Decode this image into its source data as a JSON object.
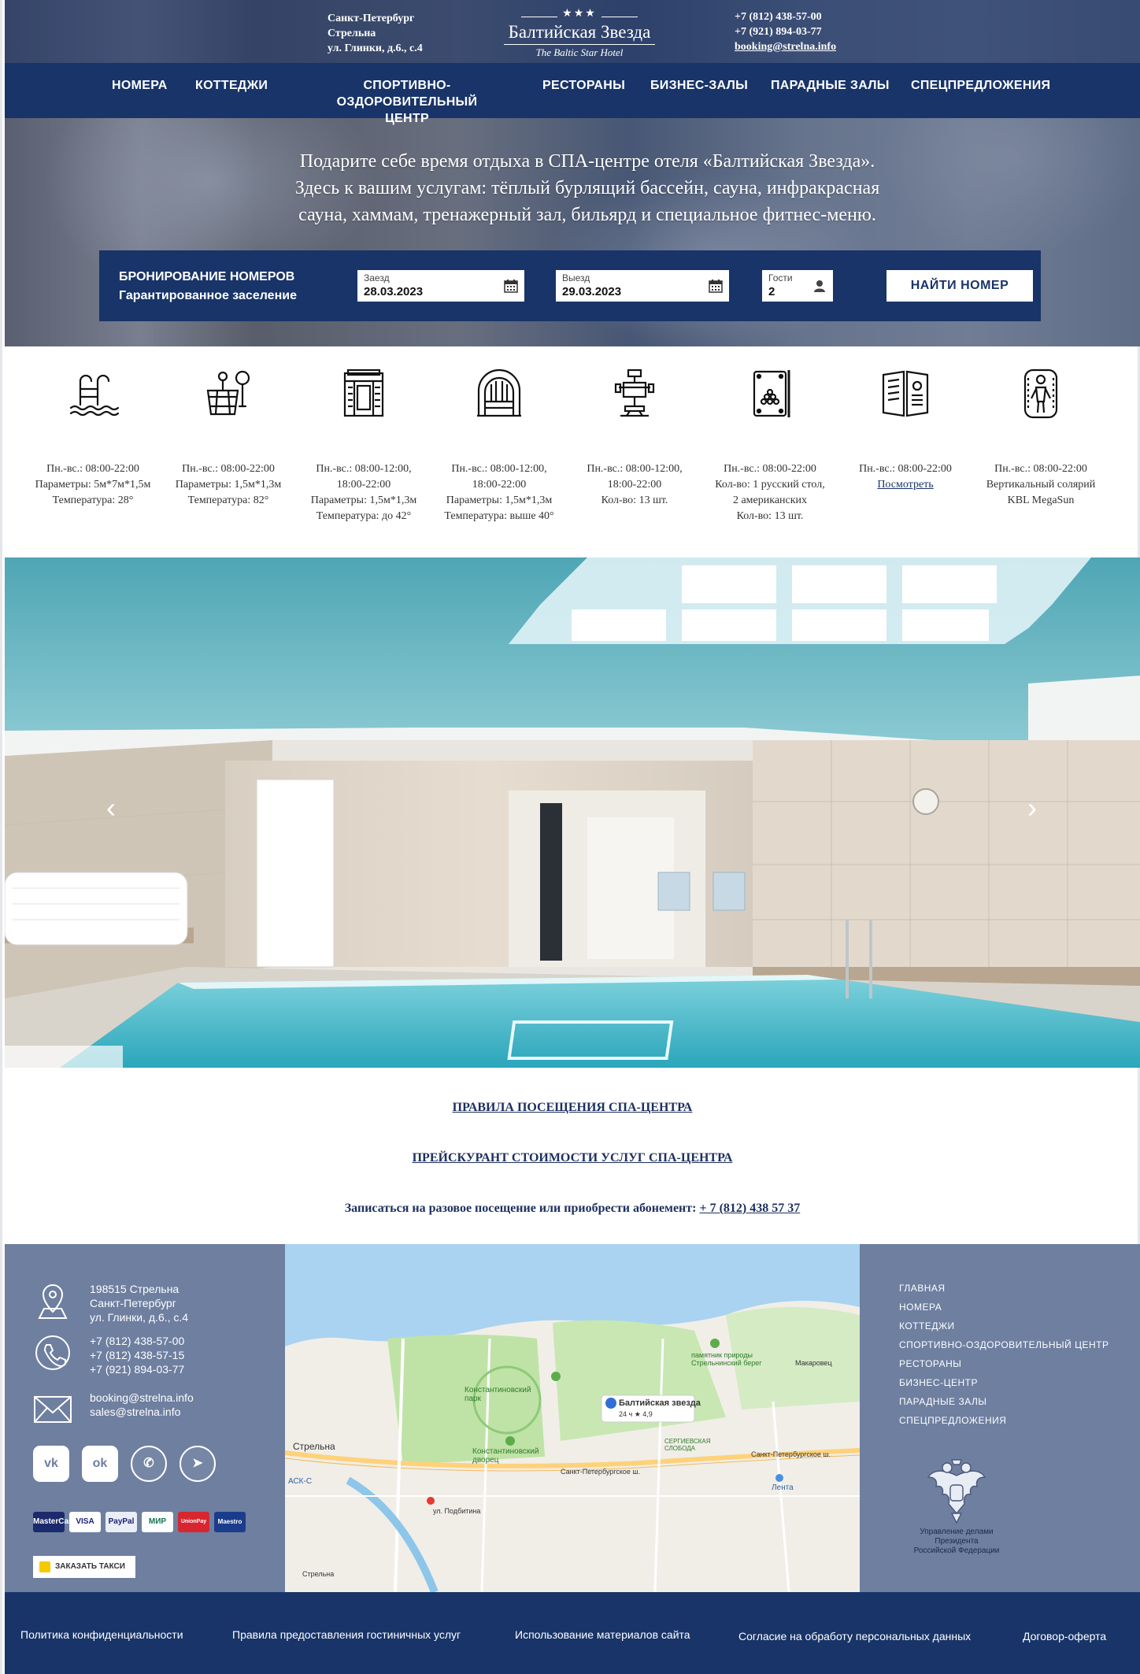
{
  "header": {
    "address_lines": [
      "Санкт-Петербург",
      "Стрельна",
      "ул. Глинки, д.6., с.4"
    ],
    "logo": {
      "stars": "★★★",
      "name": "Балтийская Звезда",
      "subtitle": "The Baltic Star Hotel"
    },
    "phones": [
      "+7 (812) 438-57-00",
      "+7 (921) 894-03-77"
    ],
    "email": "booking@strelna.info"
  },
  "nav": {
    "items": [
      "НОМЕРА",
      "КОТТЕДЖИ",
      "СПОРТИВНО-ОЗДОРОВИТЕЛЬНЫЙ",
      "ЦЕНТР",
      "РЕСТОРАНЫ",
      "БИЗНЕС-ЗАЛЫ",
      "ПАРАДНЫЕ ЗАЛЫ",
      "СПЕЦПРЕДЛОЖЕНИЯ"
    ]
  },
  "banner": {
    "lines": [
      "Подарите себе время отдыха в СПА-центре отеля «Балтийская Звезда».",
      "Здесь к вашим услугам: тёплый бурлящий бассейн, сауна, инфракрасная",
      "сауна, хаммам, тренажерный зал, бильярд и специальное фитнес-меню."
    ]
  },
  "booking": {
    "title": "БРОНИРОВАНИЕ НОМЕРОВ",
    "subtitle": "Гарантированное заселение",
    "checkin_label": "Заезд",
    "checkin_value": "28.03.2023",
    "checkout_label": "Выезд",
    "checkout_value": "29.03.2023",
    "guests_label": "Гости",
    "guests_value": "2",
    "button": "НАЙТИ НОМЕР"
  },
  "services": [
    {
      "icon": "pool-icon",
      "lines": [
        "Пн.-вс.: 08:00-22:00",
        "Параметры: 5м*7м*1,5м",
        "Температура: 28°"
      ]
    },
    {
      "icon": "sauna-bucket-icon",
      "lines": [
        "Пн.-вс.: 08:00-22:00",
        "Параметры: 1,5м*1,3м",
        "Температура: 82°"
      ]
    },
    {
      "icon": "infrared-sauna-icon",
      "lines": [
        "Пн.-вс.: 08:00-12:00,",
        "18:00-22:00",
        "Параметры: 1,5м*1,3м",
        "Температура: до 42°"
      ]
    },
    {
      "icon": "hammam-icon",
      "lines": [
        "Пн.-вс.: 08:00-12:00,",
        "18:00-22:00",
        "Параметры: 1,5м*1,3м",
        "Температура: выше 40°"
      ]
    },
    {
      "icon": "gym-machine-icon",
      "lines": [
        "Пн.-вс.: 08:00-12:00,",
        "18:00-22:00",
        "Кол-во: 13 шт."
      ]
    },
    {
      "icon": "billiard-icon",
      "lines": [
        "Пн.-вс.: 08:00-22:00",
        "Кол-во: 1 русский стол,",
        "2 американских",
        "Кол-во: 13 шт."
      ]
    },
    {
      "icon": "menu-book-icon",
      "lines": [
        "Пн.-вс.: 08:00-22:00"
      ],
      "link": "Посмотреть"
    },
    {
      "icon": "solarium-icon",
      "lines": [
        "Пн.-вс.: 08:00-22:00",
        "Вертикальный солярий",
        "KBL MegaSun"
      ]
    }
  ],
  "gallery": {
    "prev": "‹",
    "next": "›"
  },
  "links": {
    "rules": "ПРАВИЛА ПОСЕЩЕНИЯ СПА-ЦЕНТРА",
    "prices": "ПРЕЙСКУРАНТ СТОИМОСТИ УСЛУГ СПА-ЦЕНТРА",
    "signup_text": "Записаться на разовое посещение или приобрести абонемент:",
    "signup_phone": "+ 7 (812) 438 57 37"
  },
  "footer": {
    "address": [
      "198515 Стрельна",
      "Санкт-Петербург",
      "ул. Глинки, д.6., с.4"
    ],
    "phones": [
      "+7 (812) 438-57-00",
      "+7 (812) 438-57-15",
      "+7 (921) 894-03-77"
    ],
    "emails": [
      "booking@strelna.info",
      "sales@strelna.info"
    ],
    "socials": [
      "vk",
      "ok",
      "whatsapp",
      "telegram"
    ],
    "payments": [
      "MasterCard",
      "VISA",
      "PayPal",
      "МИР",
      "UnionPay",
      "Maestro"
    ],
    "taxi": "ЗАКАЗАТЬ ТАКСИ",
    "map": {
      "place": "Балтийская звезда",
      "place_rating": "24 ч ★ 4,9",
      "labels": [
        "Стрельна",
        "Константиновский парк",
        "Константиновский дворец",
        "памятник природы Стрельнинский берег",
        "СЕРГИЕВСКАЯ СЛОБОДА",
        "Санкт-Петербургское ш.",
        "Санкт-Петербургское ш.",
        "Лента",
        "АСК-С",
        "ул. Подбитина",
        "Макаровец",
        "Стрельна"
      ]
    },
    "menu": [
      "ГЛАВНАЯ",
      "НОМЕРА",
      "КОТТЕДЖИ",
      "СПОРТИВНО-ОЗДОРОВИТЕЛЬНЫЙ ЦЕНТР",
      "РЕСТОРАНЫ",
      "БИЗНЕС-ЦЕНТР",
      "ПАРАДНЫЕ ЗАЛЫ",
      "СПЕЦПРЕДЛОЖЕНИЯ"
    ],
    "emblem_text": [
      "Управление делами",
      "Президента",
      "Российской Федерации"
    ]
  },
  "bottom": {
    "links": [
      "Политика конфиденциальности",
      "Правила предоставления гостиничных услуг",
      "Использование материалов сайта",
      "Согласие на обработу персональных данных",
      "Договор-оферта"
    ]
  }
}
